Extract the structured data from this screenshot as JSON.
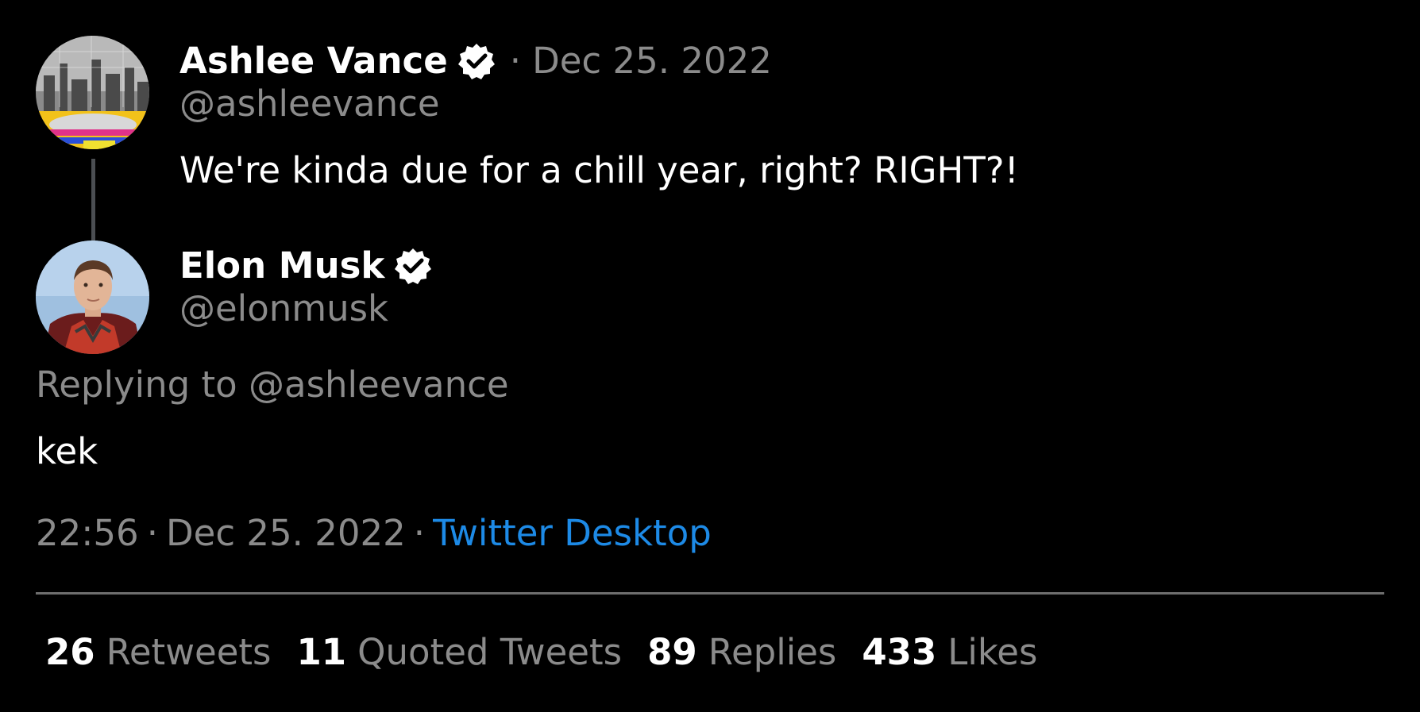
{
  "quoted_tweet": {
    "display_name": "Ashlee Vance",
    "handle": "@ashleevance",
    "separator": "·",
    "date": "Dec 25. 2022",
    "text": "We're kinda due for a chill year, right? RIGHT?!"
  },
  "main_tweet": {
    "display_name": "Elon Musk",
    "handle": "@elonmusk",
    "replying_to": "Replying to @ashleevance",
    "text": "kek",
    "time": "22:56",
    "date": "Dec 25. 2022",
    "separator": "·",
    "source": "Twitter Desktop"
  },
  "stats": [
    {
      "count": "26",
      "label": "Retweets"
    },
    {
      "count": "11",
      "label": "Quoted Tweets"
    },
    {
      "count": "89",
      "label": "Replies"
    },
    {
      "count": "433",
      "label": "Likes"
    }
  ],
  "colors": {
    "background": "#000000",
    "text": "#ffffff",
    "muted": "#8b8b8b",
    "link": "#1d8ae6",
    "divider": "#6e6e6e"
  },
  "icons": {
    "verified": "verified-badge-icon"
  }
}
